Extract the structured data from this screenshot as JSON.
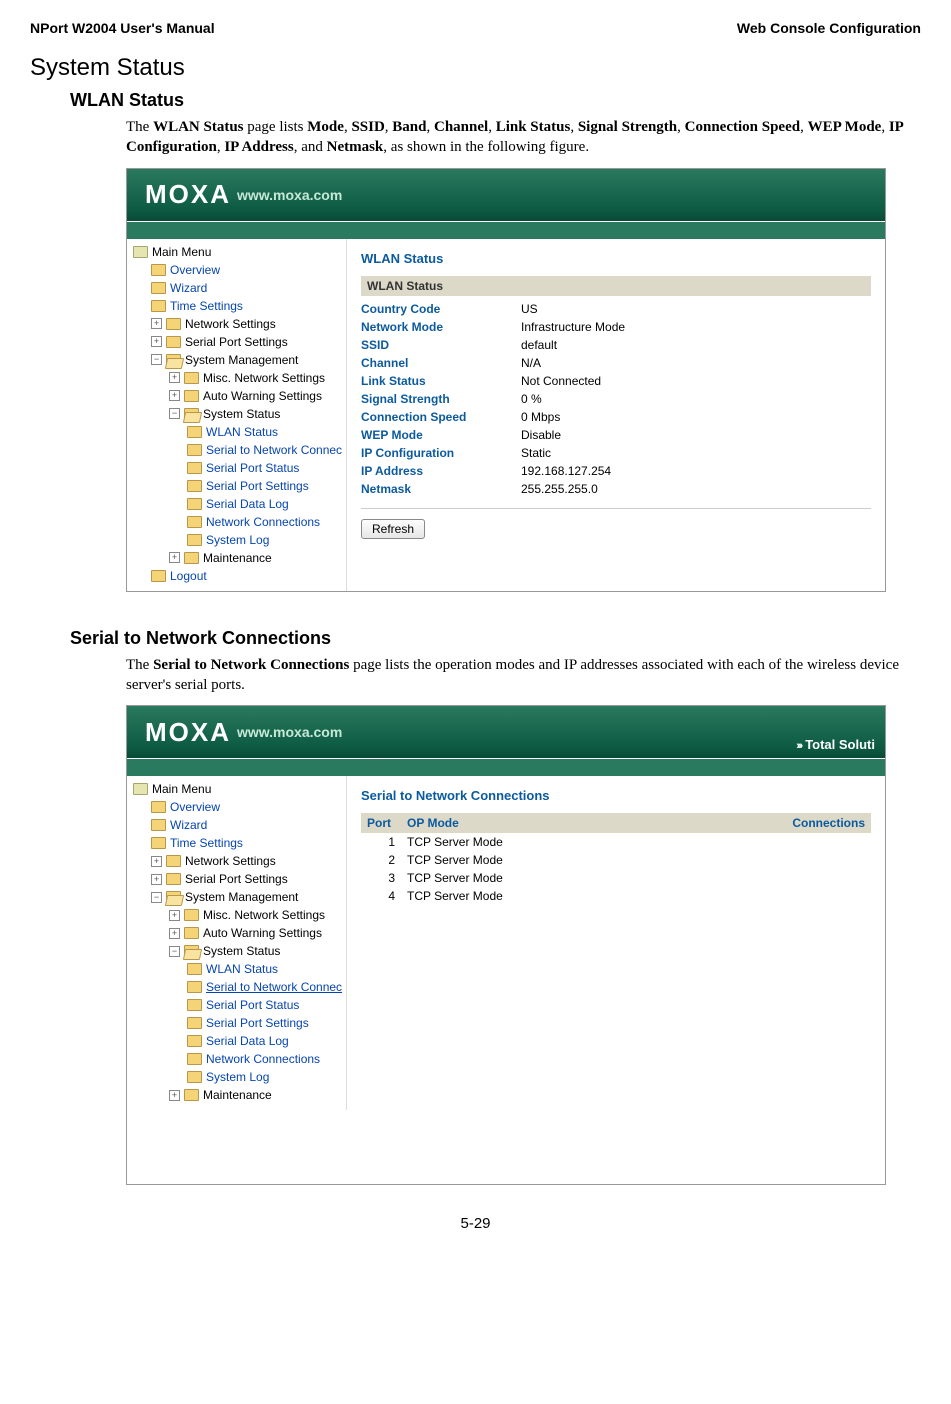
{
  "doc": {
    "header_left": "NPort W2004 User's Manual",
    "header_right": "Web Console Configuration",
    "h1": "System Status",
    "h2a": "WLAN Status",
    "para1_pre": "The ",
    "para1_b1": "WLAN Status",
    "para1_mid1": " page lists ",
    "para1_b2": "Mode",
    "c": ", ",
    "para1_b3": "SSID",
    "para1_b4": "Band",
    "para1_b5": "Channel",
    "para1_b6": "Link Status",
    "para1_b7": "Signal Strength",
    "para1_b8": "Connection Speed",
    "para1_b9": "WEP Mode",
    "para1_b10": "IP Configuration",
    "para1_b11": "IP Address",
    "para1_and": ", and ",
    "para1_b12": "Netmask",
    "para1_end": ", as shown in the following figure.",
    "h2b": "Serial to Network Connections",
    "para2_pre": "The ",
    "para2_b1": "Serial to Network Connections",
    "para2_end": " page lists the operation modes and IP addresses associated with each of the wireless device server's serial ports.",
    "page_number": "5-29"
  },
  "banner": {
    "logo": "MOXA",
    "url": "www.moxa.com",
    "right_label": "Total Soluti"
  },
  "tree": {
    "main": "Main Menu",
    "overview": "Overview",
    "wizard": "Wizard",
    "time": "Time Settings",
    "network": "Network Settings",
    "serialport": "Serial Port Settings",
    "sysmgmt": "System Management",
    "miscnet": "Misc. Network Settings",
    "autowarn": "Auto Warning Settings",
    "sysstatus": "System Status",
    "wlan": "WLAN Status",
    "s2n": "Serial to Network Connec",
    "sps": "Serial Port Status",
    "spset": "Serial Port Settings",
    "sdl": "Serial Data Log",
    "netconn": "Network Connections",
    "syslog": "System Log",
    "maint": "Maintenance",
    "logout": "Logout"
  },
  "wlan": {
    "panel_title": "WLAN Status",
    "section": "WLAN Status",
    "rows": [
      {
        "label": "Country Code",
        "value": "US"
      },
      {
        "label": "Network Mode",
        "value": "Infrastructure Mode"
      },
      {
        "label": "SSID",
        "value": "default"
      },
      {
        "label": "Channel",
        "value": "N/A"
      },
      {
        "label": "Link Status",
        "value": "Not Connected"
      },
      {
        "label": "Signal Strength",
        "value": "0 %"
      },
      {
        "label": "Connection Speed",
        "value": "0 Mbps"
      },
      {
        "label": "WEP Mode",
        "value": "Disable"
      },
      {
        "label": "IP Configuration",
        "value": "Static"
      },
      {
        "label": "IP Address",
        "value": "192.168.127.254"
      },
      {
        "label": "Netmask",
        "value": "255.255.255.0"
      }
    ],
    "refresh": "Refresh"
  },
  "s2n": {
    "panel_title": "Serial to Network Connections",
    "col_port": "Port",
    "col_mode": "OP Mode",
    "col_conn": "Connections",
    "rows": [
      {
        "port": "1",
        "mode": "TCP Server Mode"
      },
      {
        "port": "2",
        "mode": "TCP Server Mode"
      },
      {
        "port": "3",
        "mode": "TCP Server Mode"
      },
      {
        "port": "4",
        "mode": "TCP Server Mode"
      }
    ]
  }
}
